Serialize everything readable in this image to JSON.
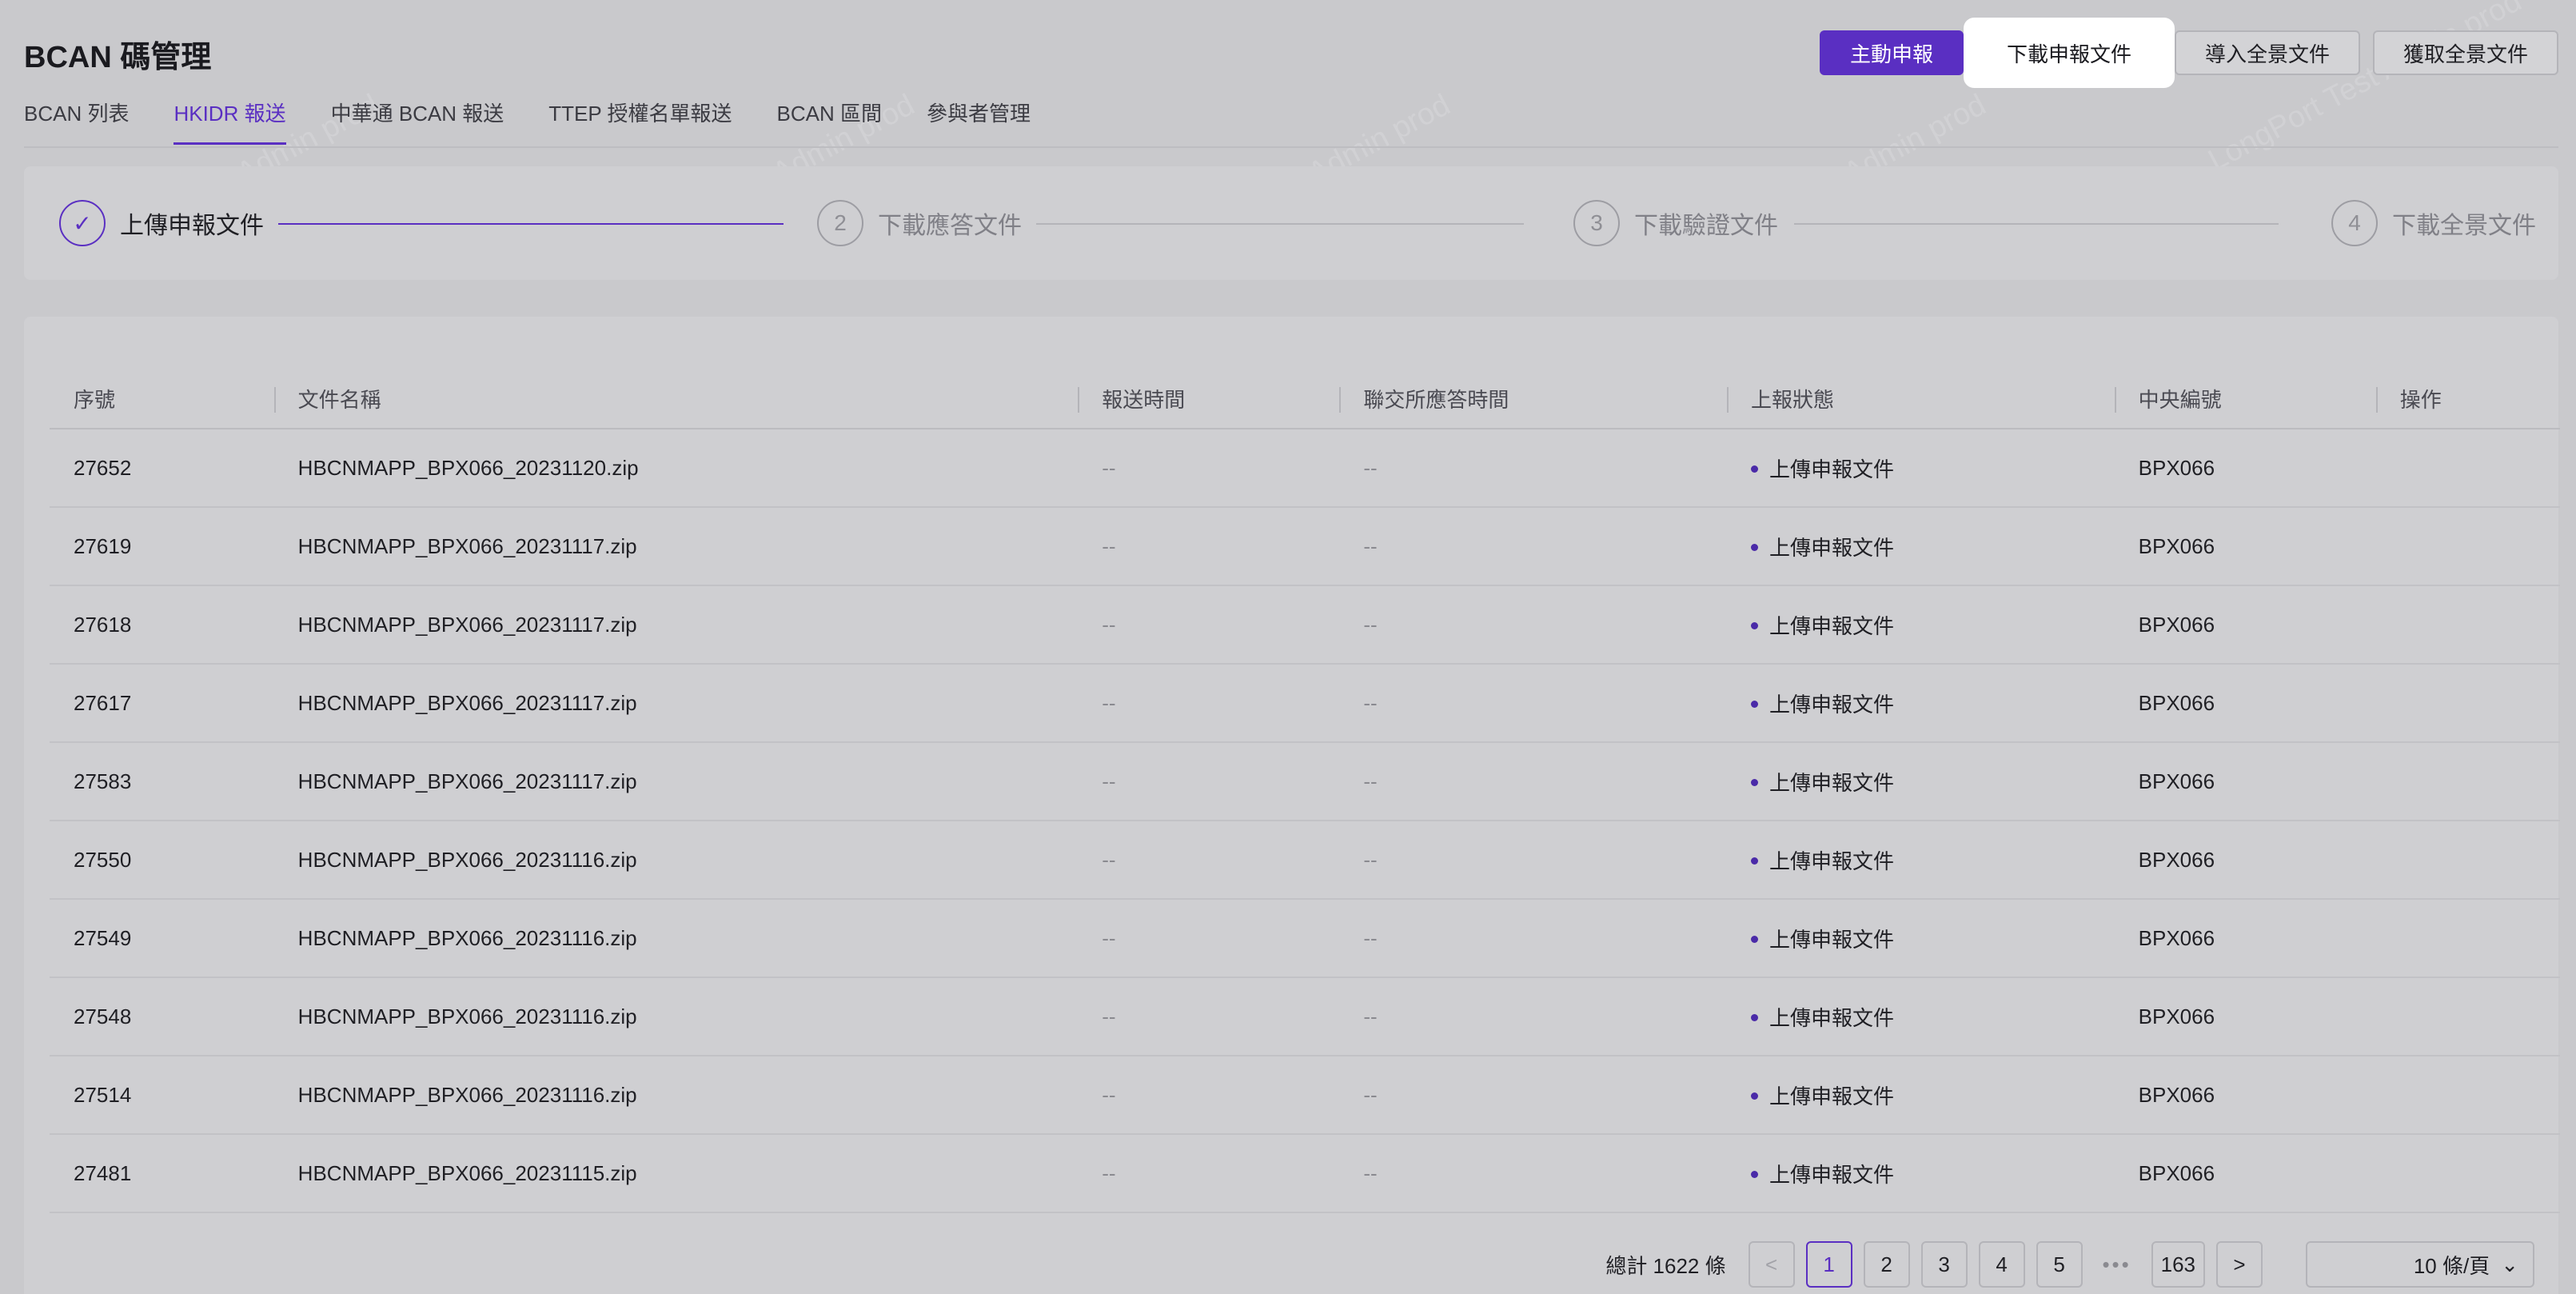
{
  "page": {
    "title": "BCAN 碼管理"
  },
  "actions": {
    "primary": "主動申報",
    "download_report": "下載申報文件",
    "import_full": "導入全景文件",
    "fetch_full": "獲取全景文件"
  },
  "tabs": [
    {
      "label": "BCAN 列表",
      "active": false
    },
    {
      "label": "HKIDR 報送",
      "active": true
    },
    {
      "label": "中華通 BCAN 報送",
      "active": false
    },
    {
      "label": "TTEP 授權名單報送",
      "active": false
    },
    {
      "label": "BCAN 區間",
      "active": false
    },
    {
      "label": "參與者管理",
      "active": false
    }
  ],
  "steps": [
    {
      "index": "✓",
      "label": "上傳申報文件",
      "status": "done"
    },
    {
      "index": "2",
      "label": "下載應答文件",
      "status": "pending"
    },
    {
      "index": "3",
      "label": "下載驗證文件",
      "status": "pending"
    },
    {
      "index": "4",
      "label": "下載全景文件",
      "status": "pending"
    }
  ],
  "table": {
    "columns": [
      "序號",
      "文件名稱",
      "報送時間",
      "聯交所應答時間",
      "上報狀態",
      "中央編號",
      "操作"
    ],
    "rows": [
      {
        "id": "27652",
        "file": "HBCNMAPP_BPX066_20231120.zip",
        "sent": "--",
        "reply": "--",
        "status": "上傳申報文件",
        "code": "BPX066"
      },
      {
        "id": "27619",
        "file": "HBCNMAPP_BPX066_20231117.zip",
        "sent": "--",
        "reply": "--",
        "status": "上傳申報文件",
        "code": "BPX066"
      },
      {
        "id": "27618",
        "file": "HBCNMAPP_BPX066_20231117.zip",
        "sent": "--",
        "reply": "--",
        "status": "上傳申報文件",
        "code": "BPX066"
      },
      {
        "id": "27617",
        "file": "HBCNMAPP_BPX066_20231117.zip",
        "sent": "--",
        "reply": "--",
        "status": "上傳申報文件",
        "code": "BPX066"
      },
      {
        "id": "27583",
        "file": "HBCNMAPP_BPX066_20231117.zip",
        "sent": "--",
        "reply": "--",
        "status": "上傳申報文件",
        "code": "BPX066"
      },
      {
        "id": "27550",
        "file": "HBCNMAPP_BPX066_20231116.zip",
        "sent": "--",
        "reply": "--",
        "status": "上傳申報文件",
        "code": "BPX066"
      },
      {
        "id": "27549",
        "file": "HBCNMAPP_BPX066_20231116.zip",
        "sent": "--",
        "reply": "--",
        "status": "上傳申報文件",
        "code": "BPX066"
      },
      {
        "id": "27548",
        "file": "HBCNMAPP_BPX066_20231116.zip",
        "sent": "--",
        "reply": "--",
        "status": "上傳申報文件",
        "code": "BPX066"
      },
      {
        "id": "27514",
        "file": "HBCNMAPP_BPX066_20231116.zip",
        "sent": "--",
        "reply": "--",
        "status": "上傳申報文件",
        "code": "BPX066"
      },
      {
        "id": "27481",
        "file": "HBCNMAPP_BPX066_20231115.zip",
        "sent": "--",
        "reply": "--",
        "status": "上傳申報文件",
        "code": "BPX066"
      }
    ]
  },
  "pagination": {
    "total": "總計 1622 條",
    "prev": "<",
    "next": ">",
    "pages": [
      "1",
      "2",
      "3",
      "4",
      "5"
    ],
    "ellipsis": "•••",
    "last": "163",
    "current": "1",
    "page_size": "10 條/頁",
    "page_size_arrow": "⌄"
  },
  "watermark": "LongPort Test Admin prod",
  "colors": {
    "accent": "#5a2fc2",
    "background": "#c9c9cc"
  }
}
